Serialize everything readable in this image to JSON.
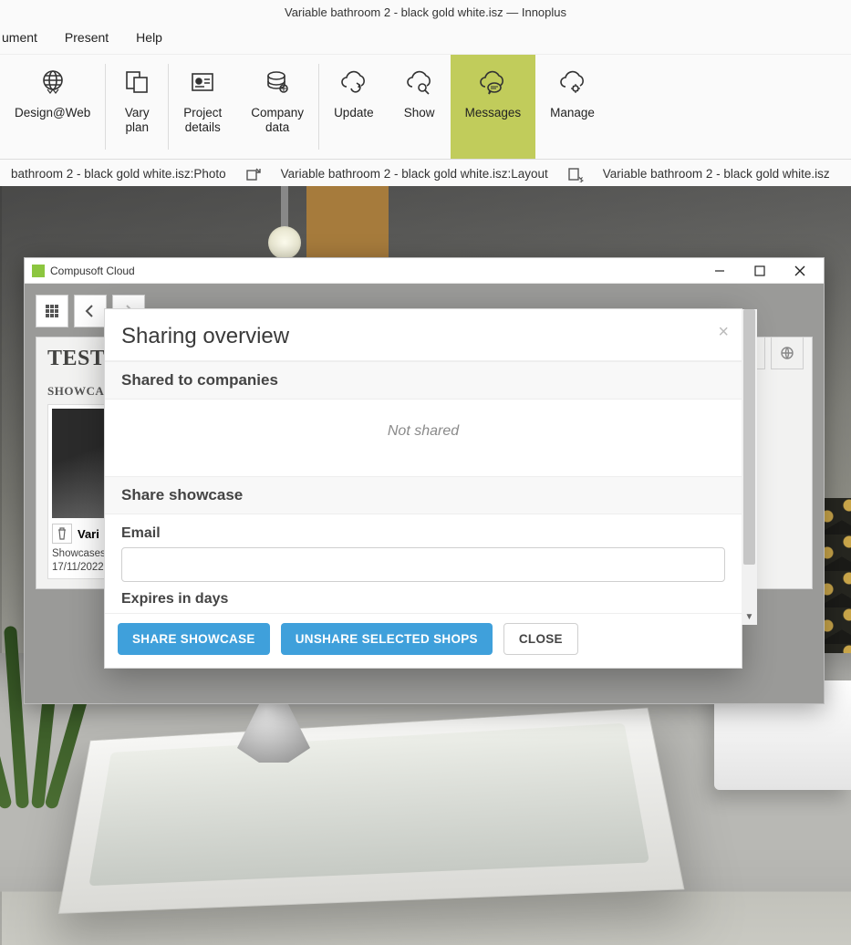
{
  "window": {
    "title": "Variable bathroom 2 - black gold white.isz — Innoplus"
  },
  "menu": {
    "items": [
      "ument",
      "Present",
      "Help"
    ]
  },
  "ribbon": {
    "items": [
      {
        "label": "Design@Web",
        "icon": "globe-icon"
      },
      {
        "label": "Vary\nplan",
        "icon": "vary-plan-icon"
      },
      {
        "label": "Project\ndetails",
        "icon": "project-details-icon"
      },
      {
        "label": "Company\ndata",
        "icon": "company-data-icon"
      },
      {
        "label": "Update",
        "icon": "update-cloud-icon"
      },
      {
        "label": "Show",
        "icon": "show-cloud-icon"
      },
      {
        "label": "Messages",
        "icon": "messages-cloud-icon",
        "active": true
      },
      {
        "label": "Manage",
        "icon": "manage-cloud-icon"
      }
    ]
  },
  "doc_tabs": {
    "items": [
      "bathroom 2 - black gold white.isz:Photo",
      "Variable bathroom 2 - black gold white.isz:Layout",
      "Variable bathroom 2 - black gold white.isz"
    ]
  },
  "cloud": {
    "title": "Compusoft Cloud",
    "panel_title": "TEST",
    "section_label": "SHOWCASES",
    "card": {
      "name": "Vari",
      "meta_line1": "Showcases",
      "meta_line2": "17/11/2022"
    }
  },
  "modal": {
    "title": "Sharing overview",
    "shared_heading": "Shared to companies",
    "not_shared": "Not shared",
    "share_heading": "Share showcase",
    "email_label": "Email",
    "email_value": "",
    "expires_label": "Expires in days",
    "buttons": {
      "share": "SHARE SHOWCASE",
      "unshare": "UNSHARE SELECTED SHOPS",
      "close": "CLOSE"
    }
  }
}
